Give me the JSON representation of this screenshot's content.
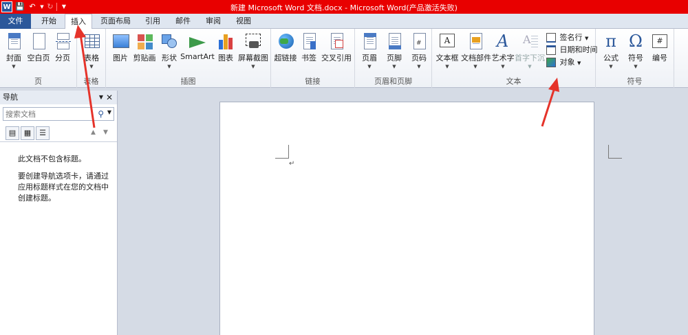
{
  "window": {
    "title": "新建 Microsoft Word 文档.docx - Microsoft Word(产品激活失败)",
    "word_icon_letter": "W"
  },
  "tabs": [
    {
      "label": "文件"
    },
    {
      "label": "开始"
    },
    {
      "label": "插入"
    },
    {
      "label": "页面布局"
    },
    {
      "label": "引用"
    },
    {
      "label": "邮件"
    },
    {
      "label": "审阅"
    },
    {
      "label": "视图"
    }
  ],
  "ribbon": {
    "pages": {
      "label": "页",
      "cover": "封面",
      "blank": "空白页",
      "break": "分页"
    },
    "tables": {
      "label": "表格",
      "table": "表格"
    },
    "illustrations": {
      "label": "插图",
      "picture": "图片",
      "clipart": "剪贴画",
      "shapes": "形状",
      "smartart": "SmartArt",
      "chart": "图表",
      "screenshot": "屏幕截图"
    },
    "links": {
      "label": "链接",
      "hyperlink": "超链接",
      "bookmark": "书签",
      "crossref": "交叉引用"
    },
    "header_footer": {
      "label": "页眉和页脚",
      "header": "页眉",
      "footer": "页脚",
      "page_number": "页码"
    },
    "text": {
      "label": "文本",
      "textbox": "文本框",
      "quickparts": "文档部件",
      "wordart": "艺术字",
      "dropcap": "首字下沉",
      "signature": "签名行",
      "datetime": "日期和时间",
      "object": "对象"
    },
    "symbols": {
      "label": "符号",
      "equation": "公式",
      "symbol": "符号",
      "number": "编号",
      "equation_glyph": "π",
      "symbol_glyph": "Ω",
      "number_glyph": "#"
    }
  },
  "nav": {
    "title": "导航",
    "search_placeholder": "搜索文档",
    "message1": "此文档不包含标题。",
    "message2": "要创建导航选项卡，请通过应用标题样式在您的文档中创建标题。"
  },
  "colors": {
    "titlebar": "#e80000",
    "file_tab": "#2b579a",
    "annotation": "#e5332a"
  }
}
